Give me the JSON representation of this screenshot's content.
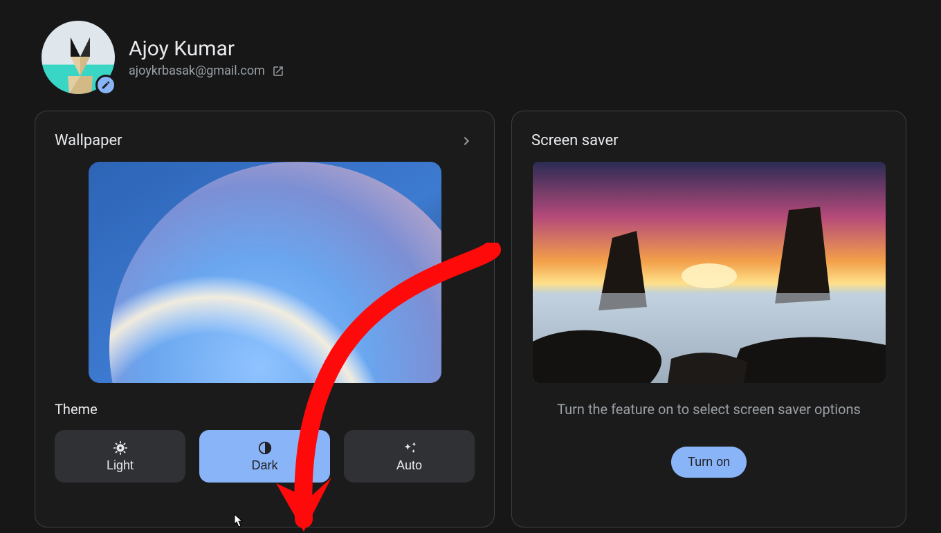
{
  "profile": {
    "name": "Ajoy Kumar",
    "email": "ajoykrbasak@gmail.com"
  },
  "wallpaper": {
    "title": "Wallpaper"
  },
  "theme": {
    "label": "Theme",
    "options": {
      "light": "Light",
      "dark": "Dark",
      "auto": "Auto"
    },
    "selected": "dark"
  },
  "screensaver": {
    "title": "Screen saver",
    "hint": "Turn the feature on to select screen saver options",
    "button": "Turn on"
  },
  "annotation": {
    "type": "arrow",
    "color": "#ff0000",
    "target": "theme-dark-button"
  }
}
